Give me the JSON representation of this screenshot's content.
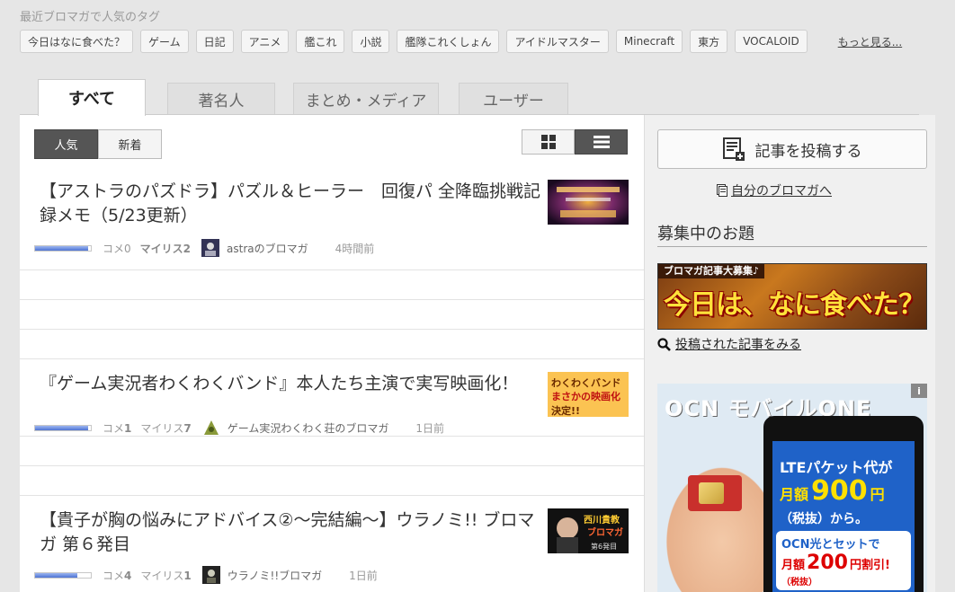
{
  "tags": {
    "title": "最近ブロマガで人気のタグ",
    "items": [
      "今日はなに食べた？",
      "ゲーム",
      "日記",
      "アニメ",
      "艦これ",
      "小説",
      "艦隊これくしょん",
      "アイドルマスター",
      "Minecraft",
      "東方",
      "VOCALOID"
    ],
    "more": "もっと見る..."
  },
  "tabs": [
    "すべて",
    "著名人",
    "まとめ・メディア",
    "ユーザー"
  ],
  "sort": {
    "popular": "人気",
    "new": "新着"
  },
  "articles": [
    {
      "title": "【アストラのパズドラ】パズル＆ヒーラー　回復パ 全降臨挑戦記録メモ（5/23更新）",
      "comments_label": "コメ",
      "comments": "0",
      "mylist_label": "マイリス",
      "mylist": "2",
      "blog": "astraのブロマガ",
      "time": "4時間前",
      "popularity": 0.95
    },
    {
      "title": "『ゲーム実況者わくわくバンド』本人たち主演で実写映画化！",
      "comments_label": "コメ",
      "comments": "1",
      "mylist_label": "マイリス",
      "mylist": "7",
      "blog": "ゲーム実況わくわく荘のブロマガ",
      "time": "1日前",
      "popularity": 0.95,
      "thumb_text": "わくわくバンドまさかの映画化決定!!"
    },
    {
      "title": "【貴子が胸の悩みにアドバイス②～完結編～】ウラノミ!! ブロマガ 第６発目",
      "comments_label": "コメ",
      "comments": "4",
      "mylist_label": "マイリス",
      "mylist": "1",
      "blog": "ウラノミ!!ブロマガ",
      "time": "1日前",
      "popularity": 0.75,
      "thumb_text": "西川貴教のブロマガ 第6発目"
    }
  ],
  "sidebar": {
    "post_button": "記事を投稿する",
    "my_blog": "自分のブロマガへ",
    "odai_title": "募集中のお題",
    "banner_head": "ブロマガ記事大募集♪",
    "banner_main": "今日は、なに食べた？",
    "view_posts": "投稿された記事をみる"
  },
  "ad": {
    "brand": "OCN モバイルONE",
    "info": "i",
    "line1": "LTEパケット代が",
    "line2_prefix": "月額",
    "line2_amount": "900",
    "line2_suffix": "円",
    "line3": "（税抜）から。",
    "box_line1": "OCN光とセットで",
    "box_prefix": "月額",
    "box_amount": "200",
    "box_suffix": "円割引!",
    "box_tax": "（税抜）"
  }
}
